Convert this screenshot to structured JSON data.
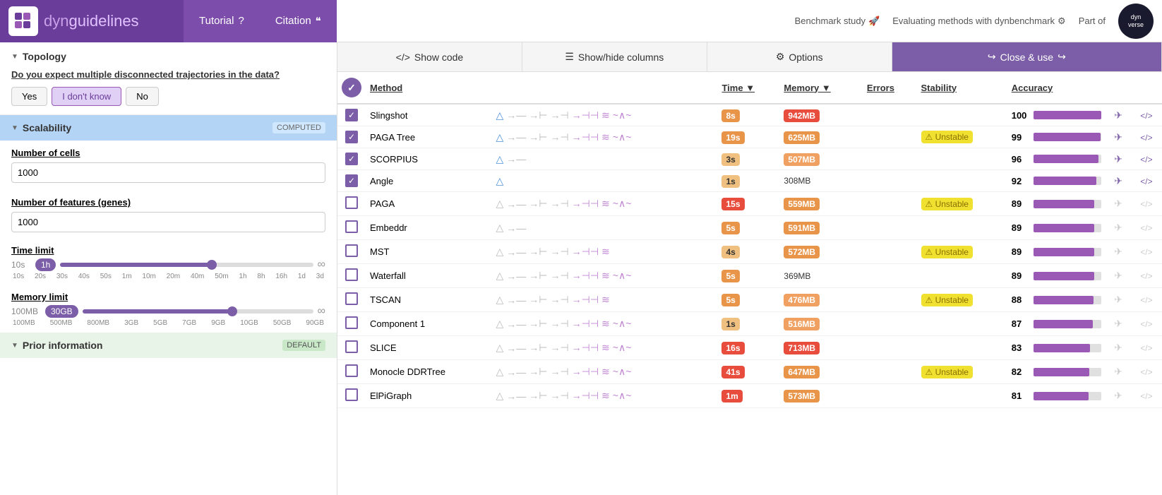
{
  "header": {
    "logo_text_dyn": "dyn",
    "logo_text_guidelines": "guidelines",
    "nav_tutorial": "Tutorial",
    "nav_citation": "Citation",
    "benchmark_study": "Benchmark study",
    "evaluating_methods": "Evaluating methods with dynbenchmark",
    "part_of": "Part of"
  },
  "left_panel": {
    "topology_section": "Topology",
    "topology_question": "Do you expect multiple disconnected trajectories in the data?",
    "topology_options": [
      "Yes",
      "I don't know",
      "No"
    ],
    "topology_active": "I don't know",
    "scalability_section": "Scalability",
    "scalability_computed": "COMPUTED",
    "cells_label": "Number of cells",
    "cells_value": "1000",
    "genes_label": "Number of features (genes)",
    "genes_value": "1000",
    "time_limit_label": "Time limit",
    "time_limit_min": "10s",
    "time_limit_val": "1h",
    "time_ticks": [
      "10s",
      "20s",
      "30s",
      "40s",
      "50s",
      "1m",
      "10m",
      "20m",
      "40m",
      "50m",
      "1h",
      "8h",
      "16h",
      "1d",
      "3d"
    ],
    "memory_limit_label": "Memory limit",
    "memory_limit_min": "100MB",
    "memory_limit_val": "30GB",
    "memory_ticks": [
      "100MB",
      "500MB",
      "800MB",
      "3GB",
      "5GB",
      "7GB",
      "9GB",
      "10GB",
      "50GB",
      "90GB"
    ],
    "prior_section": "Prior information",
    "prior_badge": "DEFAULT"
  },
  "toolbar": {
    "show_code": "Show code",
    "show_hide_columns": "Show/hide columns",
    "options": "Options",
    "close_use": "Close & use"
  },
  "table": {
    "columns": [
      "",
      "Method",
      "",
      "Time",
      "Memory",
      "Errors",
      "Stability",
      "Accuracy",
      "",
      ""
    ],
    "rows": [
      {
        "checked": true,
        "method": "Slingshot",
        "time": "8s",
        "time_class": "orange",
        "memory": "942MB",
        "mem_class": "mem-red",
        "errors": "",
        "stability": "",
        "accuracy": 100,
        "acc_pct": 100
      },
      {
        "checked": true,
        "method": "PAGA Tree",
        "time": "19s",
        "time_class": "orange",
        "memory": "625MB",
        "mem_class": "mem-orange",
        "errors": "",
        "stability": "Unstable",
        "accuracy": 99,
        "acc_pct": 99
      },
      {
        "checked": true,
        "method": "SCORPIUS",
        "time": "3s",
        "time_class": "light",
        "memory": "507MB",
        "mem_class": "mem-light-orange",
        "errors": "",
        "stability": "",
        "accuracy": 96,
        "acc_pct": 96
      },
      {
        "checked": true,
        "method": "Angle",
        "time": "1s",
        "time_class": "light",
        "memory": "308MB",
        "mem_class": "plain",
        "errors": "",
        "stability": "",
        "accuracy": 92,
        "acc_pct": 92
      },
      {
        "checked": false,
        "method": "PAGA",
        "time": "15s",
        "time_class": "red",
        "memory": "559MB",
        "mem_class": "mem-orange",
        "errors": "",
        "stability": "Unstable",
        "accuracy": 89,
        "acc_pct": 89
      },
      {
        "checked": false,
        "method": "Embeddr",
        "time": "5s",
        "time_class": "orange",
        "memory": "591MB",
        "mem_class": "mem-orange",
        "errors": "",
        "stability": "",
        "accuracy": 89,
        "acc_pct": 89
      },
      {
        "checked": false,
        "method": "MST",
        "time": "4s",
        "time_class": "light",
        "memory": "572MB",
        "mem_class": "mem-orange",
        "errors": "",
        "stability": "Unstable",
        "accuracy": 89,
        "acc_pct": 89
      },
      {
        "checked": false,
        "method": "Waterfall",
        "time": "5s",
        "time_class": "orange",
        "memory": "369MB",
        "mem_class": "plain",
        "errors": "",
        "stability": "",
        "accuracy": 89,
        "acc_pct": 89
      },
      {
        "checked": false,
        "method": "TSCAN",
        "time": "5s",
        "time_class": "orange",
        "memory": "476MB",
        "mem_class": "mem-light-orange",
        "errors": "",
        "stability": "Unstable",
        "accuracy": 88,
        "acc_pct": 88
      },
      {
        "checked": false,
        "method": "Component 1",
        "time": "1s",
        "time_class": "light",
        "memory": "516MB",
        "mem_class": "mem-light-orange",
        "errors": "",
        "stability": "",
        "accuracy": 87,
        "acc_pct": 87
      },
      {
        "checked": false,
        "method": "SLICE",
        "time": "16s",
        "time_class": "red",
        "memory": "713MB",
        "mem_class": "mem-red",
        "errors": "",
        "stability": "",
        "accuracy": 83,
        "acc_pct": 83
      },
      {
        "checked": false,
        "method": "Monocle DDRTree",
        "time": "41s",
        "time_class": "red",
        "memory": "647MB",
        "mem_class": "mem-orange",
        "errors": "",
        "stability": "Unstable",
        "accuracy": 82,
        "acc_pct": 82
      },
      {
        "checked": false,
        "method": "ElPiGraph",
        "time": "1m",
        "time_class": "red",
        "memory": "573MB",
        "mem_class": "mem-orange",
        "errors": "",
        "stability": "",
        "accuracy": 81,
        "acc_pct": 81
      }
    ]
  }
}
